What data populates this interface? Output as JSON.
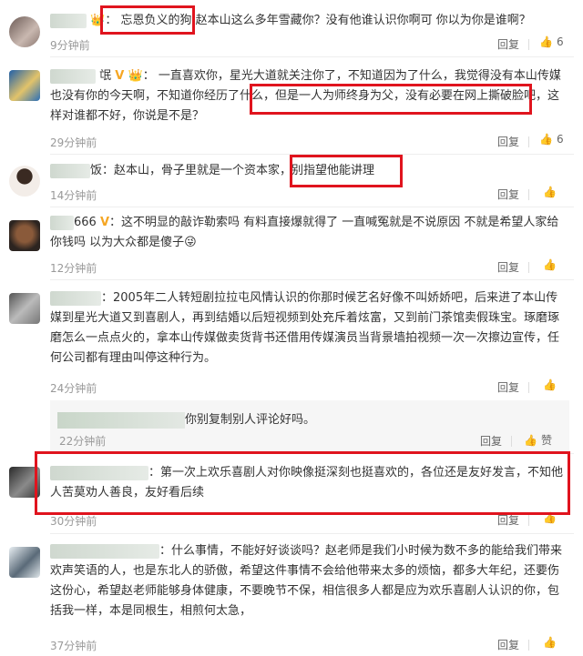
{
  "labels": {
    "reply": "回复",
    "praise": "赞"
  },
  "comments": [
    {
      "text_a": "忘恩负义的狗",
      "text_b": "赵本山这么多年雪藏你？没有他谁认识你啊可 你以为你是谁啊？",
      "time": "9分钟前",
      "likes": "6"
    },
    {
      "text_a": "一直喜欢你，星光大道就关注你了，不知道因为了什么，我觉得没有本山传媒也没有你的今天啊，不知道你经历了什么，",
      "text_b": "但是一人为师终身为父，没有必要在网上撕破脸吧",
      "text_c": "，这样对谁都不好，你说是不是？",
      "time": "29分钟前",
      "likes": "6"
    },
    {
      "name_tail": "饭",
      "text_a": "：赵本山，骨子里就是一个资本家，",
      "text_b": "别指望他能讲理",
      "time": "14分钟前",
      "likes": ""
    },
    {
      "name_tail": "666",
      "text_a": "：这不明显的敲诈勒索吗 有料直接爆就得了 一直喊冤就是不说原因 不就是希望人家给你钱吗 以为大众都是傻子",
      "time": "12分钟前",
      "likes": ""
    },
    {
      "text_a": "2005年二人转短剧拉拉屯风情认识的你那时候艺名好像不叫娇娇吧，后来进了本山传媒到星光大道又到喜剧人，再到结婚以后短视频到处充斥着炫富，又到前门茶馆卖假珠宝。琢磨琢磨怎么一点点火的，拿本山传媒做卖货背书还借用传媒演员当背景墙拍视频一次一次擦边宣传，任何公司都有理由叫停这种行为。",
      "time": "24分钟前",
      "likes": ""
    },
    {
      "sub_text": "你别复制别人评论好吗。",
      "sub_time": "22分钟前"
    },
    {
      "text_a": "第一次上欢乐喜剧人对你映像挺深刻也挺喜欢的，各位还是友好发言，不知他人苦莫劝人善良，友好看后续",
      "time": "30分钟前",
      "likes": ""
    },
    {
      "text_a": "什么事情，不能好好谈谈吗？赵老师是我们小时候为数不多的能给我们带来欢声笑语的人，也是东北人的骄傲，希望这件事情不会给他带来太多的烦恼，都多大年纪，还要伤这份心，希望赵老师能够身体健康，不要晚节不保，相信很多人都是应为欢乐喜剧人认识的你，包括我一样，本是同根生，相煎何太急，",
      "time": "37分钟前",
      "likes": ""
    }
  ]
}
